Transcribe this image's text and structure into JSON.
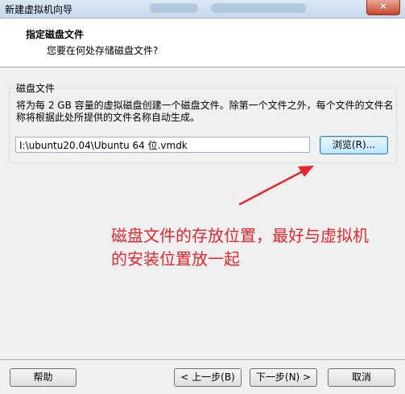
{
  "window": {
    "title": "新建虚拟机向导",
    "close_glyph": "✕"
  },
  "header": {
    "title": "指定磁盘文件",
    "subtitle": "您要在何处存储磁盘文件?"
  },
  "disk_group": {
    "label": "磁盘文件",
    "description": "将为每 2 GB 容量的虚拟磁盘创建一个磁盘文件。除第一个文件之外，每个文件的文件名称将根据此处所提供的文件名称自动生成。",
    "path_value": "I:\\ubuntu20.04\\Ubuntu 64 位.vmdk",
    "browse_label": "浏览(R)..."
  },
  "annotation": {
    "text": "磁盘文件的存放位置，最好与虚拟机的安装位置放一起",
    "color": "#e8262e"
  },
  "footer": {
    "help_label": "帮助",
    "back_label": "< 上一步(B)",
    "next_label": "下一步(N) >",
    "cancel_label": "取消"
  }
}
